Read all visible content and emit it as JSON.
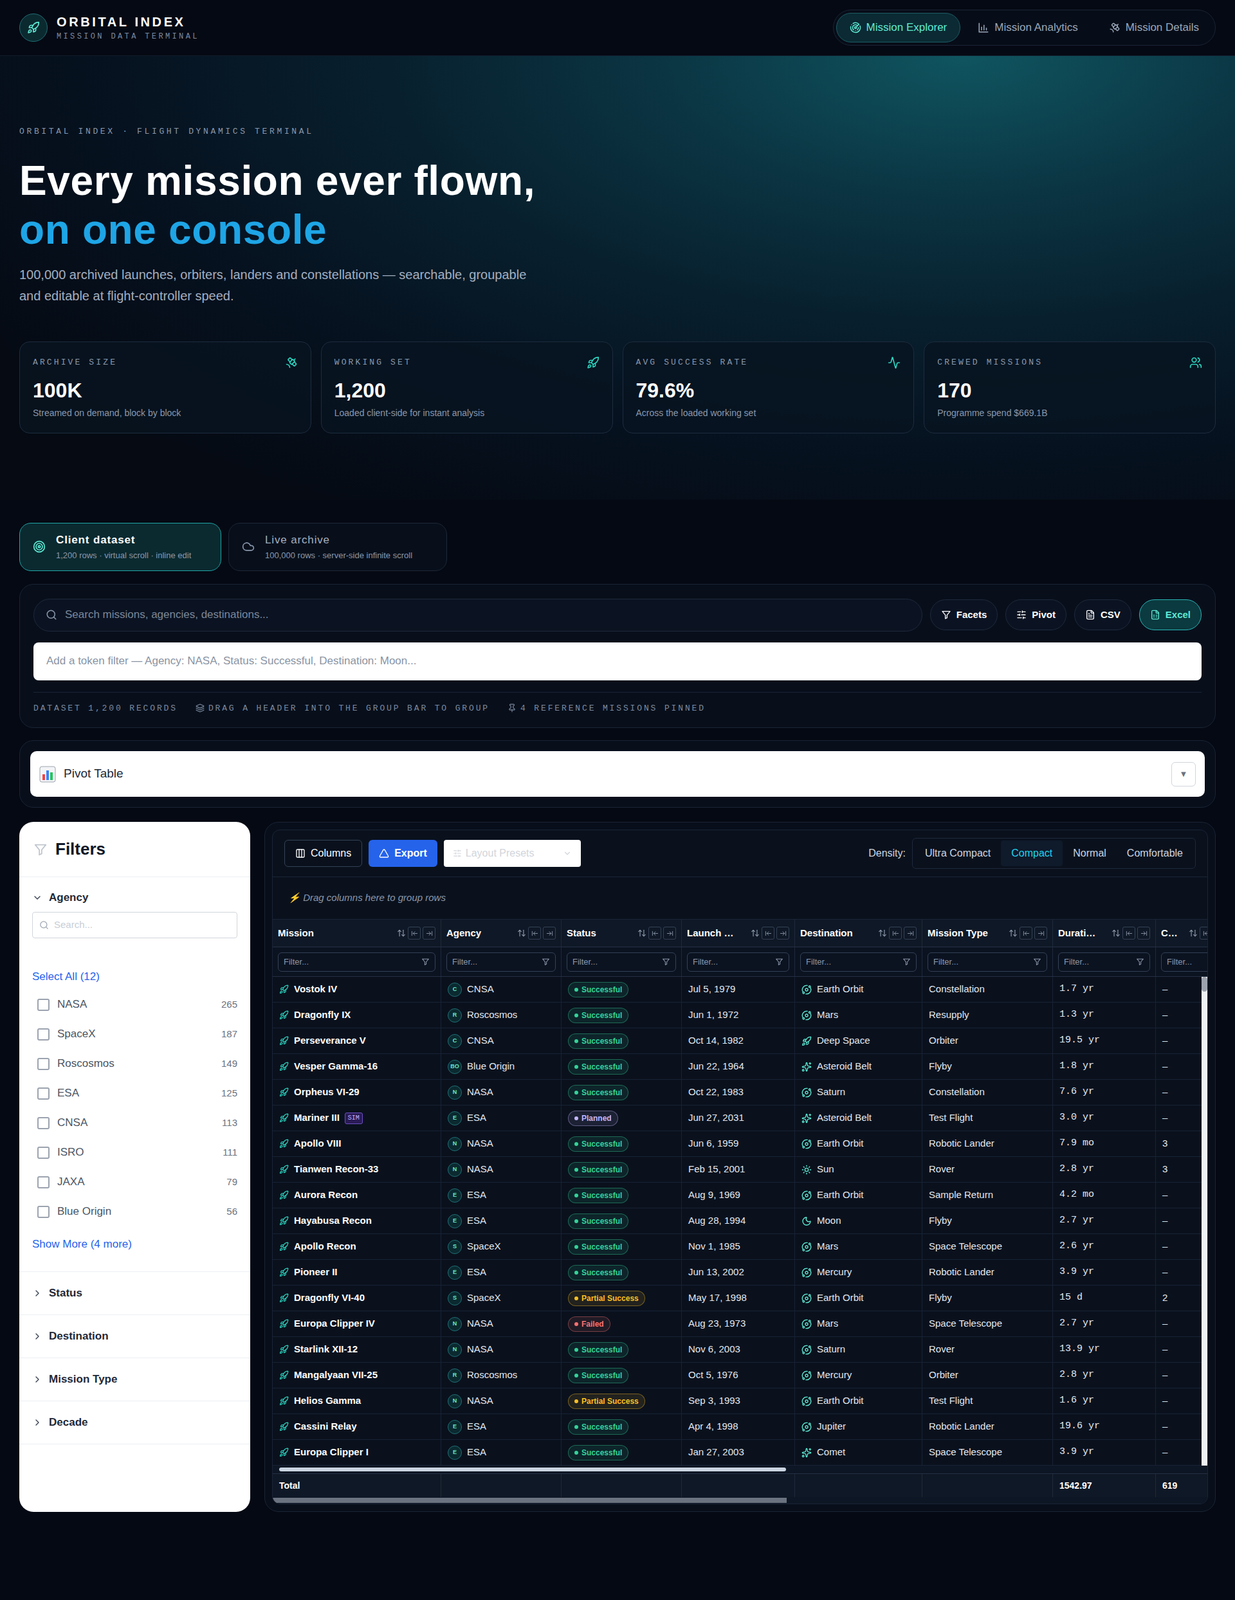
{
  "header": {
    "brand": "ORBITAL INDEX",
    "tagline": "MISSION DATA TERMINAL",
    "nav": [
      {
        "label": "Mission Explorer",
        "selected": true
      },
      {
        "label": "Mission Analytics",
        "selected": false
      },
      {
        "label": "Mission Details",
        "selected": false
      }
    ]
  },
  "hero": {
    "eyebrow": "ORBITAL INDEX · FLIGHT DYNAMICS TERMINAL",
    "title_line1": "Every mission ever flown,",
    "title_line2": "on one console",
    "description": "100,000 archived launches, orbiters, landers and constellations — searchable, groupable and editable at flight-controller speed.",
    "stats": [
      {
        "label": "ARCHIVE SIZE",
        "value": "100K",
        "sub": "Streamed on demand, block by block"
      },
      {
        "label": "WORKING SET",
        "value": "1,200",
        "sub": "Loaded client-side for instant analysis"
      },
      {
        "label": "AVG SUCCESS RATE",
        "value": "79.6%",
        "sub": "Across the loaded working set"
      },
      {
        "label": "CREWED MISSIONS",
        "value": "170",
        "sub": "Programme spend $669.1B"
      }
    ]
  },
  "dataset_tabs": [
    {
      "title": "Client dataset",
      "sub": "1,200 rows · virtual scroll · inline edit",
      "selected": true
    },
    {
      "title": "Live archive",
      "sub": "100,000 rows · server-side infinite scroll",
      "selected": false
    }
  ],
  "search": {
    "placeholder": "Search missions, agencies, destinations...",
    "buttons": [
      {
        "label": "Facets",
        "selected": false
      },
      {
        "label": "Pivot",
        "selected": false
      },
      {
        "label": "CSV",
        "selected": false
      },
      {
        "label": "Excel",
        "selected": true
      }
    ],
    "token_placeholder": "Add a token filter — Agency: NASA, Status: Successful, Destination: Moon...",
    "meta": [
      "DATASET 1,200 RECORDS",
      "DRAG A HEADER INTO THE GROUP BAR TO GROUP",
      "4 REFERENCE MISSIONS PINNED"
    ]
  },
  "pivot": {
    "title": "Pivot Table",
    "toggle": "▼",
    "expanded": false
  },
  "filters": {
    "title": "Filters",
    "sections": [
      {
        "label": "Agency",
        "expanded": true,
        "search_placeholder": "Search...",
        "select_all": "Select All (12)",
        "options": [
          {
            "label": "NASA",
            "count": "265",
            "checked": false
          },
          {
            "label": "SpaceX",
            "count": "187",
            "checked": false
          },
          {
            "label": "Roscosmos",
            "count": "149",
            "checked": false
          },
          {
            "label": "ESA",
            "count": "125",
            "checked": false
          },
          {
            "label": "CNSA",
            "count": "113",
            "checked": false
          },
          {
            "label": "ISRO",
            "count": "111",
            "checked": false
          },
          {
            "label": "JAXA",
            "count": "79",
            "checked": false
          },
          {
            "label": "Blue Origin",
            "count": "56",
            "checked": false
          }
        ],
        "show_more": "Show More (4 more)"
      },
      {
        "label": "Status",
        "expanded": false
      },
      {
        "label": "Destination",
        "expanded": false
      },
      {
        "label": "Mission Type",
        "expanded": false
      },
      {
        "label": "Decade",
        "expanded": false
      }
    ]
  },
  "grid": {
    "columns_button": "Columns",
    "export_button": "Export",
    "layout_presets": "Layout Presets",
    "density_label": "Density:",
    "densities": [
      {
        "label": "Ultra Compact",
        "selected": false
      },
      {
        "label": "Compact",
        "selected": true
      },
      {
        "label": "Normal",
        "selected": false
      },
      {
        "label": "Comfortable",
        "selected": false
      }
    ],
    "group_bar": "⚡ Drag columns here to group rows",
    "filter_placeholder": "Filter...",
    "columns": [
      {
        "label": "Mission"
      },
      {
        "label": "Agency"
      },
      {
        "label": "Status"
      },
      {
        "label": "Launch …"
      },
      {
        "label": "Destination"
      },
      {
        "label": "Mission Type"
      },
      {
        "label": "Durati…"
      },
      {
        "label": "C…"
      }
    ],
    "rows": [
      {
        "mission": "Vostok IV",
        "agency_initial": "C",
        "agency": "CNSA",
        "status": "Successful",
        "status_color": "#34d399",
        "launch": "Jul 5, 1979",
        "destination": "Earth Orbit",
        "destination_kind": "planet",
        "type": "Constellation",
        "duration": "1.7 yr",
        "crew": "–"
      },
      {
        "mission": "Dragonfly IX",
        "agency_initial": "R",
        "agency": "Roscosmos",
        "status": "Successful",
        "status_color": "#34d399",
        "launch": "Jun 1, 1972",
        "destination": "Mars",
        "destination_kind": "planet",
        "type": "Resupply",
        "duration": "1.3 yr",
        "crew": "–"
      },
      {
        "mission": "Perseverance V",
        "agency_initial": "C",
        "agency": "CNSA",
        "status": "Successful",
        "status_color": "#34d399",
        "launch": "Oct 14, 1982",
        "destination": "Deep Space",
        "destination_kind": "rocket",
        "type": "Orbiter",
        "duration": "19.5 yr",
        "crew": "–"
      },
      {
        "mission": "Vesper Gamma-16",
        "agency_initial": "BO",
        "agency": "Blue Origin",
        "status": "Successful",
        "status_color": "#34d399",
        "launch": "Jun 22, 1964",
        "destination": "Asteroid Belt",
        "destination_kind": "sparkle",
        "type": "Flyby",
        "duration": "1.8 yr",
        "crew": "–"
      },
      {
        "mission": "Orpheus VI-29",
        "agency_initial": "N",
        "agency": "NASA",
        "status": "Successful",
        "status_color": "#34d399",
        "launch": "Oct 22, 1983",
        "destination": "Saturn",
        "destination_kind": "planet",
        "type": "Constellation",
        "duration": "7.6 yr",
        "crew": "–"
      },
      {
        "mission": "Mariner III",
        "tag": "SIM",
        "agency_initial": "E",
        "agency": "ESA",
        "status": "Planned",
        "status_color": "#c4b5fd",
        "launch": "Jun 27, 2031",
        "destination": "Asteroid Belt",
        "destination_kind": "sparkle",
        "type": "Test Flight",
        "duration": "3.0 yr",
        "crew": "–"
      },
      {
        "mission": "Apollo VIII",
        "agency_initial": "N",
        "agency": "NASA",
        "status": "Successful",
        "status_color": "#34d399",
        "launch": "Jun 6, 1959",
        "destination": "Earth Orbit",
        "destination_kind": "planet",
        "type": "Robotic Lander",
        "duration": "7.9 mo",
        "crew": "3"
      },
      {
        "mission": "Tianwen Recon-33",
        "agency_initial": "N",
        "agency": "NASA",
        "status": "Successful",
        "status_color": "#34d399",
        "launch": "Feb 15, 2001",
        "destination": "Sun",
        "destination_kind": "sun",
        "type": "Rover",
        "duration": "2.8 yr",
        "crew": "3"
      },
      {
        "mission": "Aurora Recon",
        "agency_initial": "E",
        "agency": "ESA",
        "status": "Successful",
        "status_color": "#34d399",
        "launch": "Aug 9, 1969",
        "destination": "Earth Orbit",
        "destination_kind": "planet",
        "type": "Sample Return",
        "duration": "4.2 mo",
        "crew": "–"
      },
      {
        "mission": "Hayabusa Recon",
        "agency_initial": "E",
        "agency": "ESA",
        "status": "Successful",
        "status_color": "#34d399",
        "launch": "Aug 28, 1994",
        "destination": "Moon",
        "destination_kind": "moon",
        "type": "Flyby",
        "duration": "2.7 yr",
        "crew": "–"
      },
      {
        "mission": "Apollo Recon",
        "agency_initial": "S",
        "agency": "SpaceX",
        "status": "Successful",
        "status_color": "#34d399",
        "launch": "Nov 1, 1985",
        "destination": "Mars",
        "destination_kind": "planet",
        "type": "Space Telescope",
        "duration": "2.6 yr",
        "crew": "–"
      },
      {
        "mission": "Pioneer II",
        "agency_initial": "E",
        "agency": "ESA",
        "status": "Successful",
        "status_color": "#34d399",
        "launch": "Jun 13, 2002",
        "destination": "Mercury",
        "destination_kind": "planet",
        "type": "Robotic Lander",
        "duration": "3.9 yr",
        "crew": "–"
      },
      {
        "mission": "Dragonfly VI-40",
        "agency_initial": "S",
        "agency": "SpaceX",
        "status": "Partial Success",
        "status_color": "#fbbf24",
        "launch": "May 17, 1998",
        "destination": "Earth Orbit",
        "destination_kind": "planet",
        "type": "Flyby",
        "duration": "15 d",
        "crew": "2"
      },
      {
        "mission": "Europa Clipper IV",
        "agency_initial": "N",
        "agency": "NASA",
        "status": "Failed",
        "status_color": "#f87171",
        "launch": "Aug 23, 1973",
        "destination": "Mars",
        "destination_kind": "planet",
        "type": "Space Telescope",
        "duration": "2.7 yr",
        "crew": "–"
      },
      {
        "mission": "Starlink XII-12",
        "agency_initial": "N",
        "agency": "NASA",
        "status": "Successful",
        "status_color": "#34d399",
        "launch": "Nov 6, 2003",
        "destination": "Saturn",
        "destination_kind": "planet",
        "type": "Rover",
        "duration": "13.9 yr",
        "crew": "–"
      },
      {
        "mission": "Mangalyaan VII-25",
        "agency_initial": "R",
        "agency": "Roscosmos",
        "status": "Successful",
        "status_color": "#34d399",
        "launch": "Oct 5, 1976",
        "destination": "Mercury",
        "destination_kind": "planet",
        "type": "Orbiter",
        "duration": "2.8 yr",
        "crew": "–"
      },
      {
        "mission": "Helios Gamma",
        "agency_initial": "N",
        "agency": "NASA",
        "status": "Partial Success",
        "status_color": "#fbbf24",
        "launch": "Sep 3, 1993",
        "destination": "Earth Orbit",
        "destination_kind": "planet",
        "type": "Test Flight",
        "duration": "1.6 yr",
        "crew": "–"
      },
      {
        "mission": "Cassini Relay",
        "agency_initial": "E",
        "agency": "ESA",
        "status": "Successful",
        "status_color": "#34d399",
        "launch": "Apr 4, 1998",
        "destination": "Jupiter",
        "destination_kind": "planet",
        "type": "Robotic Lander",
        "duration": "19.6 yr",
        "crew": "–"
      },
      {
        "mission": "Europa Clipper I",
        "agency_initial": "E",
        "agency": "ESA",
        "status": "Successful",
        "status_color": "#34d399",
        "launch": "Jan 27, 2003",
        "destination": "Comet",
        "destination_kind": "sparkle",
        "type": "Space Telescope",
        "duration": "3.9 yr",
        "crew": "–"
      }
    ],
    "totals": {
      "label": "Total",
      "duration": "1542.97",
      "crew": "619"
    },
    "scroll": {
      "horizontal_level": 0.55,
      "vertical_level": 0.03
    }
  }
}
